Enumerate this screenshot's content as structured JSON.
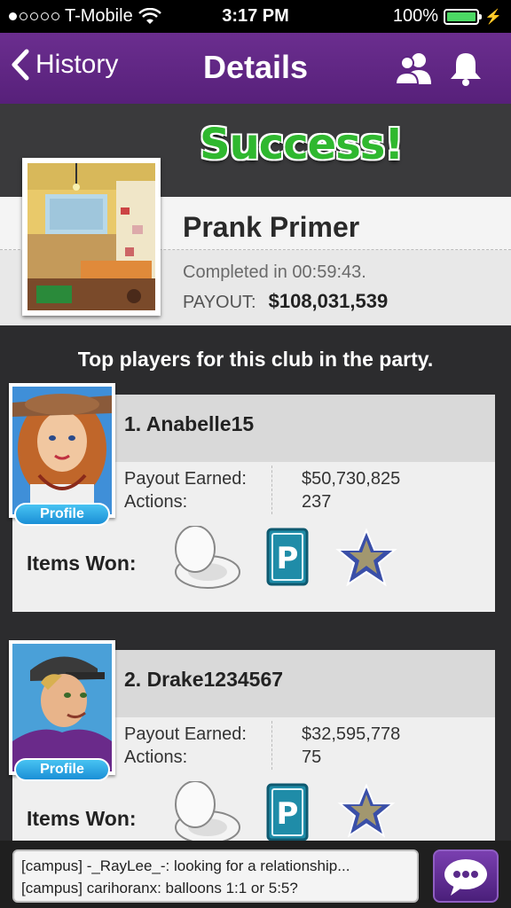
{
  "status_bar": {
    "carrier": "T-Mobile",
    "time": "3:17 PM",
    "battery": "100%",
    "signal_bars": 1
  },
  "nav": {
    "back_label": "History",
    "title": "Details",
    "icons": [
      "friends-icon",
      "bell-icon"
    ]
  },
  "result": {
    "headline": "Success!",
    "club_name": "Prank Primer",
    "completed_text": "Completed in 00:59:43.",
    "payout_label": "PAYOUT:",
    "payout_value": "$108,031,539"
  },
  "top_players_title": "Top players for this club in the party.",
  "players": [
    {
      "name": "1. Anabelle15",
      "payout_label": "Payout Earned:",
      "payout_value": "$50,730,825",
      "actions_label": "Actions:",
      "actions_value": "237",
      "items_label": "Items Won:",
      "profile_label": "Profile",
      "items": [
        "toilet-seat-icon",
        "parking-sign-icon",
        "star-icon"
      ]
    },
    {
      "name": "2. Drake1234567",
      "payout_label": "Payout Earned:",
      "payout_value": "$32,595,778",
      "actions_label": "Actions:",
      "actions_value": "75",
      "items_label": "Items Won:",
      "profile_label": "Profile",
      "items": [
        "toilet-seat-icon",
        "parking-sign-icon",
        "star-icon"
      ]
    }
  ],
  "chat": {
    "line1": "[campus] -_RayLee_-: looking for a relationship...",
    "line2": "[campus] carihoranx: balloons 1:1 or 5:5?"
  },
  "colors": {
    "nav_purple": "#5e2484",
    "success_green": "#2fb82f",
    "profile_blue": "#1a8fd6"
  }
}
